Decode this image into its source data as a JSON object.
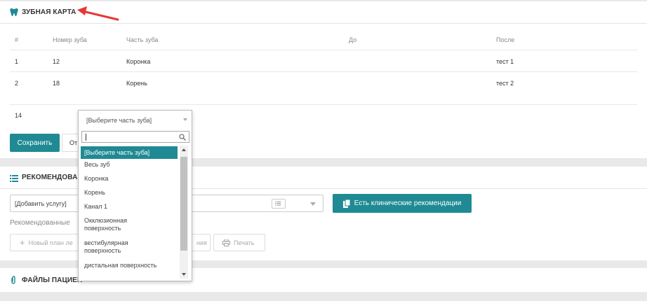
{
  "dental_chart": {
    "title": "ЗУБНАЯ КАРТА",
    "columns": [
      "#",
      "Номер зуба",
      "Часть зуба",
      "До",
      "После"
    ],
    "rows": [
      {
        "num": "1",
        "tooth": "12",
        "part": "Коронка",
        "before": "",
        "after": "тест 1"
      },
      {
        "num": "2",
        "tooth": "18",
        "part": "Корень",
        "before": "",
        "after": "тест 2"
      }
    ],
    "new_tooth_value": "14",
    "save_label": "Сохранить",
    "cancel_label": "От"
  },
  "recommendations": {
    "title": "РЕКОМЕНДОВАН",
    "service_placeholder": "[Добавить услугу]",
    "clinical_button": "Есть клинические рекомендации",
    "recommended_text": "Рекомендованные",
    "new_plan_label": "Новый план ле",
    "hidden_button_label": "ния",
    "print_label": "Печать"
  },
  "files": {
    "title": "ФАЙЛЫ ПАЦИЕН"
  },
  "dropdown": {
    "current": "[Выберите часть зуба]",
    "search_value": "",
    "options": [
      {
        "label": "[Выберите часть зуба]",
        "selected": true
      },
      {
        "label": "Весь зуб",
        "selected": false
      },
      {
        "label": "Коронка",
        "selected": false
      },
      {
        "label": "Корень",
        "selected": false
      },
      {
        "label": "Канал 1",
        "selected": false
      },
      {
        "label": "Окклюзионная поверхность",
        "selected": false
      },
      {
        "label": "вестибулярная поверхность",
        "selected": false
      },
      {
        "label": "дистальная поверхность",
        "selected": false
      }
    ]
  },
  "colors": {
    "accent": "#1f8a93",
    "arrow": "#e53935"
  }
}
